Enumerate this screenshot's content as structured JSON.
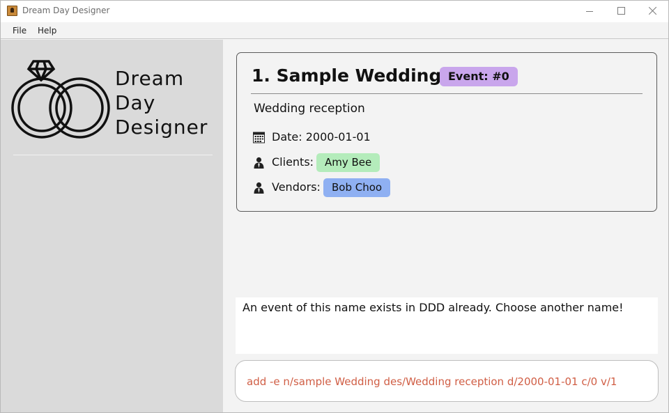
{
  "window": {
    "title": "Dream Day Designer",
    "icon": "app-icon",
    "controls": [
      "minimize-icon",
      "maximize-icon",
      "close-icon"
    ]
  },
  "menu": {
    "file": "File",
    "help": "Help"
  },
  "sidebar": {
    "logo_lines": [
      "Dream",
      "Day",
      "Designer"
    ]
  },
  "event": {
    "title": "1. Sample Wedding",
    "badge": "Event: #0",
    "description": "Wedding reception",
    "date_label": "Date: 2000-01-01",
    "clients_label": "Clients:",
    "clients": [
      "Amy Bee"
    ],
    "vendors_label": "Vendors:",
    "vendors": [
      "Bob Choo"
    ]
  },
  "result": {
    "message": "An event of this name exists in DDD already. Choose another name!"
  },
  "command": {
    "text": "add -e n/sample Wedding des/Wedding reception d/2000-01-01 c/0 v/1"
  },
  "colors": {
    "badge": "#c9a6ec",
    "client_tag": "#b4ecbb",
    "vendor_tag": "#8fb0f2",
    "command_text": "#d05e45",
    "sidebar_bg": "#dadada"
  }
}
